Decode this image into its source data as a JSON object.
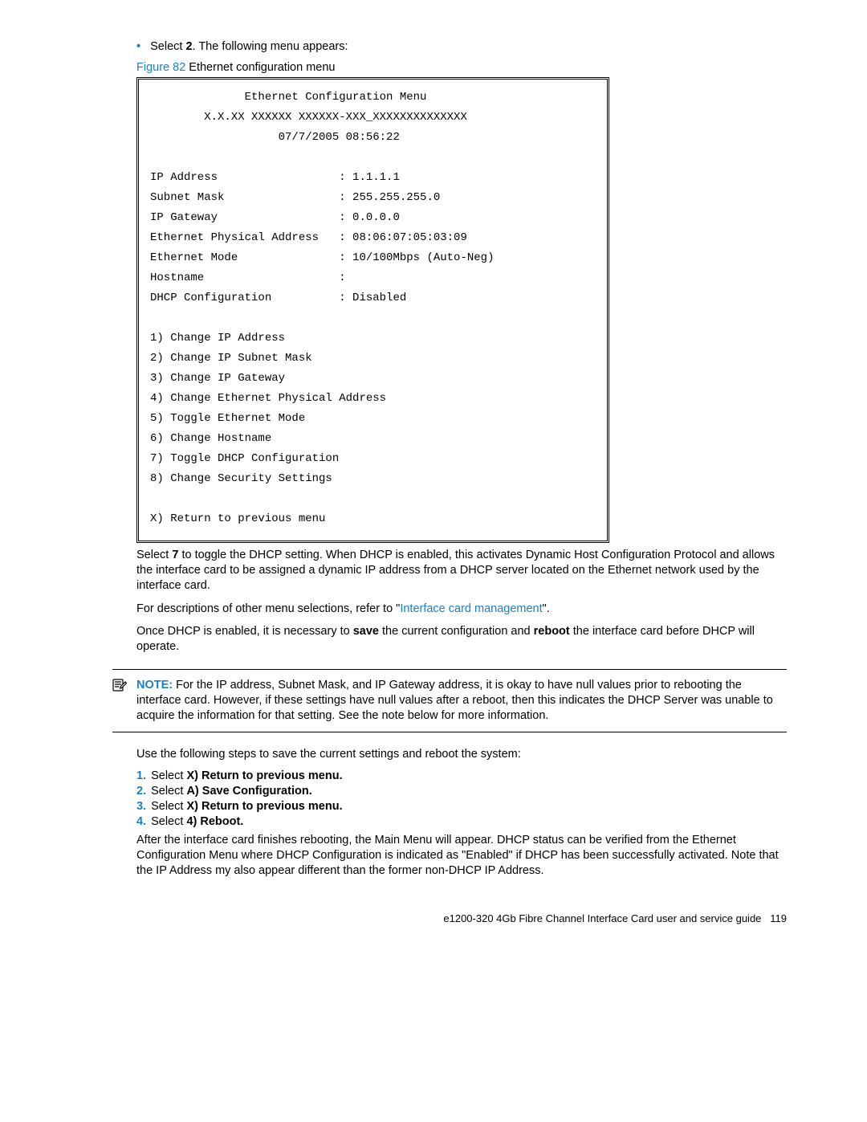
{
  "intro": {
    "select_prefix": "Select ",
    "select_bold": "2",
    "select_suffix": ". The following menu appears:"
  },
  "figure": {
    "label": "Figure 82",
    "caption": "  Ethernet configuration menu"
  },
  "terminal": {
    "title": "Ethernet Configuration Menu",
    "version": "X.X.XX XXXXXX XXXXXX-XXX_XXXXXXXXXXXXXX",
    "timestamp": "07/7/2005 08:56:22",
    "fields": [
      {
        "label": "IP Address",
        "value": "1.1.1.1"
      },
      {
        "label": "Subnet Mask",
        "value": "255.255.255.0"
      },
      {
        "label": "IP Gateway",
        "value": "0.0.0.0"
      },
      {
        "label": "Ethernet Physical Address",
        "value": "08:06:07:05:03:09"
      },
      {
        "label": "Ethernet Mode",
        "value": "10/100Mbps (Auto-Neg)"
      },
      {
        "label": "Hostname",
        "value": ""
      },
      {
        "label": "DHCP Configuration",
        "value": "Disabled"
      }
    ],
    "options": [
      "1) Change IP Address",
      "2) Change IP Subnet Mask",
      "3) Change IP Gateway",
      "4) Change Ethernet Physical Address",
      "5) Toggle Ethernet Mode",
      "6) Change Hostname",
      "7) Toggle DHCP Configuration",
      "8) Change Security Settings"
    ],
    "exit": "X) Return to previous menu"
  },
  "p1": {
    "a": "Select ",
    "b": "7",
    "c": " to toggle the DHCP setting. When DHCP is enabled, this activates Dynamic Host Configuration Protocol and allows the interface card to be assigned a dynamic IP address from a DHCP server located on the Ethernet network used by the interface card."
  },
  "p2": {
    "a": "For descriptions of other menu selections, refer to \"",
    "link": "Interface card management",
    "b": "\"."
  },
  "p3": {
    "a": "Once DHCP is enabled, it is necessary to ",
    "b": "save",
    "c": " the current configuration and ",
    "d": "reboot",
    "e": " the interface card before DHCP will operate."
  },
  "note": {
    "label": "NOTE:",
    "text": "   For the IP address, Subnet Mask, and IP Gateway address, it is okay to have null values prior to rebooting the interface card. However, if these settings have null values after a reboot, then this indicates the DHCP Server was unable to acquire the information for that setting. See the note below for more information."
  },
  "p4": "Use the following steps to save the current settings and reboot the system:",
  "steps": [
    {
      "n": "1.",
      "a": "Select ",
      "b": "X) Return to previous menu."
    },
    {
      "n": "2.",
      "a": "Select ",
      "b": "A) Save Configuration."
    },
    {
      "n": "3.",
      "a": "Select ",
      "b": "X) Return to previous menu."
    },
    {
      "n": "4.",
      "a": "Select ",
      "b": "4) Reboot."
    }
  ],
  "p5": "After the interface card finishes rebooting, the Main Menu will appear. DHCP status can be verified from the Ethernet Configuration Menu where DHCP Configuration is indicated as \"Enabled\" if DHCP has been successfully activated. Note that the IP Address my also appear different than the former non-DHCP IP Address.",
  "footer": {
    "title": "e1200-320 4Gb Fibre Channel Interface Card user and service guide",
    "page": "119"
  }
}
